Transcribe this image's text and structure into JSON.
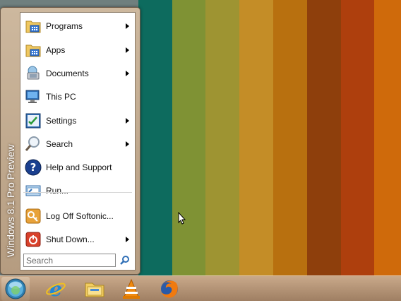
{
  "wallpaper": {
    "stripes": [
      {
        "color": "#6f7f7e",
        "width": 213
      },
      {
        "color": "#0d6b5e",
        "width": 52
      },
      {
        "color": "#7f9234",
        "width": 52
      },
      {
        "color": "#9e9432",
        "width": 52
      },
      {
        "color": "#c48d27",
        "width": 52
      },
      {
        "color": "#b8700f",
        "width": 52
      },
      {
        "color": "#8e3f0c",
        "width": 52
      },
      {
        "color": "#ae3f0d",
        "width": 52
      },
      {
        "color": "#cf6a0b",
        "width": 41
      }
    ]
  },
  "start_menu": {
    "side_title": "Windows 8.1 Pro Preview",
    "items": [
      {
        "label": "Programs",
        "icon": "programs-folder-icon",
        "submenu": true
      },
      {
        "label": "Apps",
        "icon": "apps-folder-icon",
        "submenu": true
      },
      {
        "label": "Documents",
        "icon": "documents-icon",
        "submenu": true
      },
      {
        "label": "This PC",
        "icon": "computer-icon",
        "submenu": false
      },
      {
        "label": "Settings",
        "icon": "settings-icon",
        "submenu": true
      },
      {
        "label": "Search",
        "icon": "search-magnifier-icon",
        "submenu": true
      },
      {
        "label": "Help and Support",
        "icon": "help-icon",
        "submenu": false
      },
      {
        "label": "Run...",
        "icon": "run-icon",
        "submenu": false
      },
      {
        "label": "Log Off Softonic...",
        "icon": "log-off-icon",
        "submenu": false
      },
      {
        "label": "Shut Down...",
        "icon": "shutdown-icon",
        "submenu": true
      }
    ],
    "search": {
      "placeholder": "Search"
    }
  },
  "taskbar": {
    "buttons": [
      {
        "name": "start-orb-icon"
      },
      {
        "name": "internet-explorer-icon"
      },
      {
        "name": "file-explorer-icon"
      },
      {
        "name": "vlc-icon"
      },
      {
        "name": "firefox-icon"
      }
    ]
  }
}
